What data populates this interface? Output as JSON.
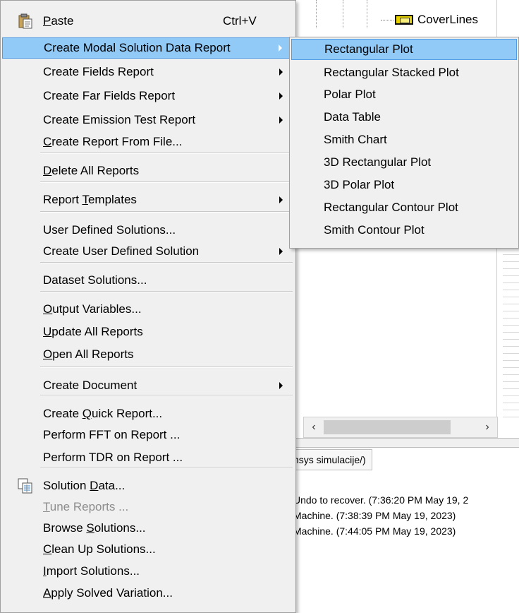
{
  "background": {
    "tree_node_label": "CoverLines",
    "path_tab_text": "nsys simulacije/)",
    "log_lines": [
      "Undo to recover. (7:36:20 PM  May 19, 2",
      "Machine. (7:38:39 PM  May 19, 2023)",
      "Machine. (7:44:05 PM  May 19, 2023)"
    ]
  },
  "main_menu": {
    "items": [
      {
        "pre": "",
        "u": "P",
        "post": "aste",
        "shortcut": "Ctrl+V",
        "icon": "paste-icon"
      },
      {
        "pre": "Create Modal Solution Data Report",
        "u": "",
        "post": "",
        "submenu": true,
        "highlighted": true
      },
      {
        "pre": "Create Fields Report",
        "u": "",
        "post": "",
        "submenu": true
      },
      {
        "pre": "Create Far Fields Report",
        "u": "",
        "post": "",
        "submenu": true
      },
      {
        "pre": "Create Emission Test Report",
        "u": "",
        "post": "",
        "submenu": true
      },
      {
        "pre": "",
        "u": "C",
        "post": "reate Report From File...",
        "submenu": false
      },
      {
        "pre": "",
        "u": "D",
        "post": "elete All Reports"
      },
      {
        "pre": "Report ",
        "u": "T",
        "post": "emplates",
        "submenu": true
      },
      {
        "pre": "User Defined Solutions...",
        "u": "",
        "post": ""
      },
      {
        "pre": "Create User Defined Solution",
        "u": "",
        "post": "",
        "submenu": true
      },
      {
        "pre": "Dataset Solutions...",
        "u": "",
        "post": ""
      },
      {
        "pre": "",
        "u": "O",
        "post": "utput Variables..."
      },
      {
        "pre": "",
        "u": "U",
        "post": "pdate All Reports"
      },
      {
        "pre": "",
        "u": "O",
        "post": "pen All Reports"
      },
      {
        "pre": "Create Document",
        "u": "",
        "post": "",
        "submenu": true
      },
      {
        "pre": "Create ",
        "u": "Q",
        "post": "uick Report..."
      },
      {
        "pre": "Perform FFT on Report ...",
        "u": "",
        "post": ""
      },
      {
        "pre": "Perform TDR on Report ...",
        "u": "",
        "post": ""
      },
      {
        "pre": "Solution ",
        "u": "D",
        "post": "ata...",
        "icon": "solution-data-icon"
      },
      {
        "pre": "",
        "u": "T",
        "post": "une Reports ...",
        "disabled": true
      },
      {
        "pre": "Browse ",
        "u": "S",
        "post": "olutions..."
      },
      {
        "pre": "",
        "u": "C",
        "post": "lean Up Solutions..."
      },
      {
        "pre": "",
        "u": "I",
        "post": "mport Solutions..."
      },
      {
        "pre": "",
        "u": "A",
        "post": "pply Solved Variation..."
      }
    ]
  },
  "sub_menu": {
    "items": [
      {
        "label": "Rectangular Plot",
        "highlighted": true
      },
      {
        "label": "Rectangular Stacked Plot"
      },
      {
        "label": "Polar Plot"
      },
      {
        "label": "Data Table"
      },
      {
        "label": "Smith Chart"
      },
      {
        "label": "3D Rectangular Plot"
      },
      {
        "label": "3D Polar Plot"
      },
      {
        "label": "Rectangular Contour Plot"
      },
      {
        "label": "Smith Contour Plot"
      }
    ]
  },
  "colors": {
    "menu_bg": "#f0f0f0",
    "highlight_bg": "#91c9f7",
    "highlight_border": "#4f9be4",
    "disabled_text": "#8d8d8d"
  }
}
